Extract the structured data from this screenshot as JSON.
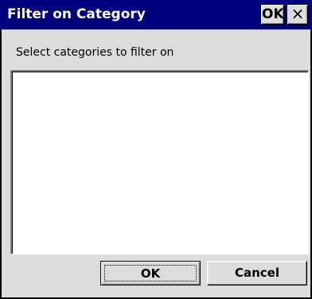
{
  "window": {
    "title": "Filter on Category",
    "ok_label": "OK",
    "close_label": "×"
  },
  "main": {
    "instruction": "Select categories to filter on",
    "categories": []
  },
  "buttons": {
    "ok_label": "OK",
    "cancel_label": "Cancel"
  },
  "colors": {
    "titlebar": "#00007f",
    "dialog_face": "#dcdcdc",
    "list_background": "#ffffff"
  }
}
